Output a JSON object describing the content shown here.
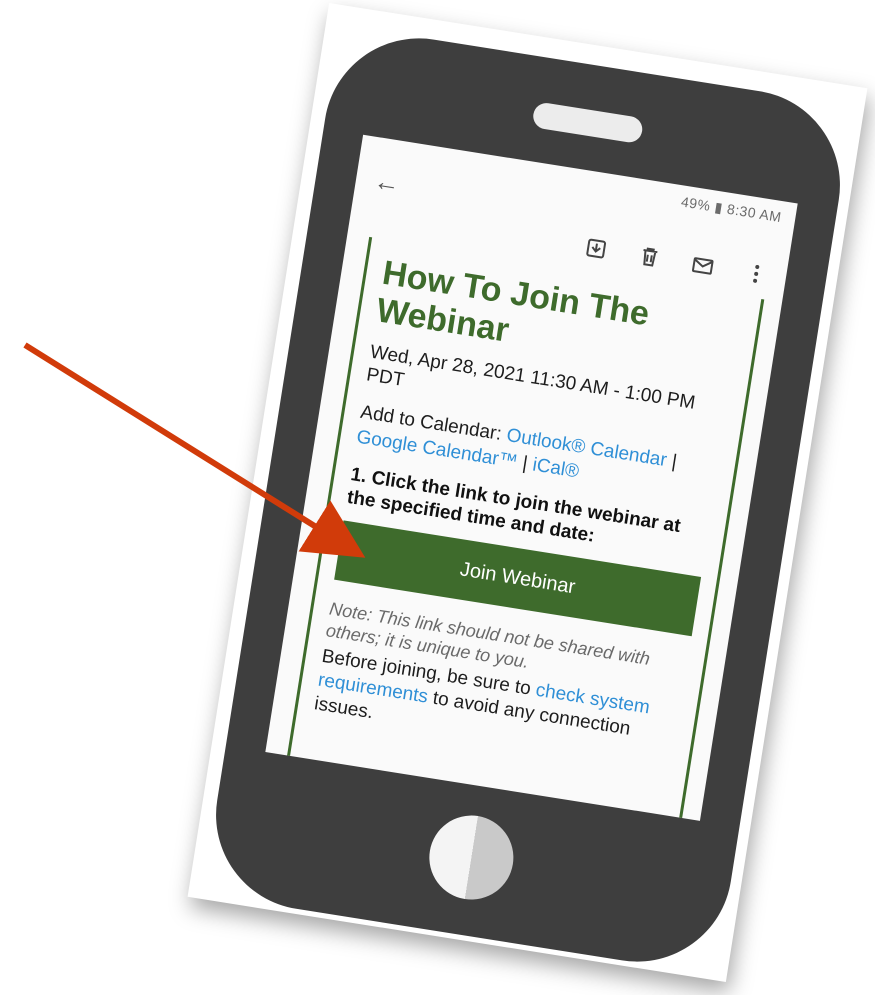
{
  "status_bar": {
    "text": "49% ▮ 8:30 AM"
  },
  "toolbar": {
    "icons": [
      "archive-icon",
      "trash-icon",
      "mail-icon",
      "more-vert-icon"
    ],
    "back_icon": "arrow-left-icon"
  },
  "email": {
    "title": "How To Join The Webinar",
    "date": "Wed, Apr 28, 2021 11:30 AM - 1:00 PM PDT",
    "calendar_prefix": "Add to Calendar: ",
    "outlook_label": "Outlook® Calendar",
    "sep1": " | ",
    "google_label": "Google Calendar™",
    "sep2": " | ",
    "ical_label": "iCal®",
    "step1": "1. Click the link to join the webinar at the specified time and date:",
    "join_button": "Join Webinar",
    "note": "Note: This link should not be shared with others; it is unique to you.",
    "before_prefix": "Before joining, be sure to ",
    "check_link": "check system requirements",
    "before_suffix": " to avoid any connection issues."
  },
  "colors": {
    "accent_green": "#3e6b2c",
    "link_blue": "#2f8fd6",
    "phone_body": "#3e3e3e",
    "arrow_red": "#d13b0a"
  }
}
